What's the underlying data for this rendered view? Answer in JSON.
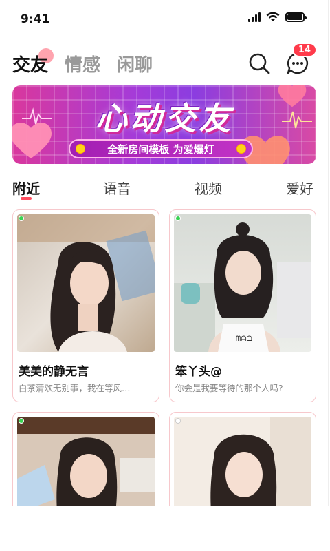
{
  "status_bar": {
    "time": "9:41"
  },
  "top_nav": {
    "tabs": [
      {
        "label": "交友",
        "active": true
      },
      {
        "label": "情感",
        "active": false
      },
      {
        "label": "闲聊",
        "active": false
      }
    ],
    "message_badge": "14"
  },
  "banner": {
    "title": "心动交友",
    "subtitle": "全新房间模板 为爱爆灯"
  },
  "categories": [
    {
      "label": "附近",
      "active": true
    },
    {
      "label": "语音",
      "active": false
    },
    {
      "label": "视频",
      "active": false
    },
    {
      "label": "爱好",
      "active": false
    }
  ],
  "cards": [
    {
      "name": "美美的静无言",
      "bio": "白茶清欢无别事，我在等风…",
      "online": true
    },
    {
      "name": "笨丫头@",
      "bio": "你会是我要等待的那个人吗?",
      "online": true
    },
    {
      "name": "",
      "bio": "",
      "online": true
    },
    {
      "name": "",
      "bio": "",
      "online": false
    }
  ],
  "colors": {
    "accent": "#ff4d5f",
    "badge": "#ff3b4b",
    "card_border": "#f7c8cc"
  },
  "icons": [
    "signal-icon",
    "wifi-icon",
    "battery-icon",
    "search-icon",
    "message-icon",
    "heart-icon"
  ]
}
